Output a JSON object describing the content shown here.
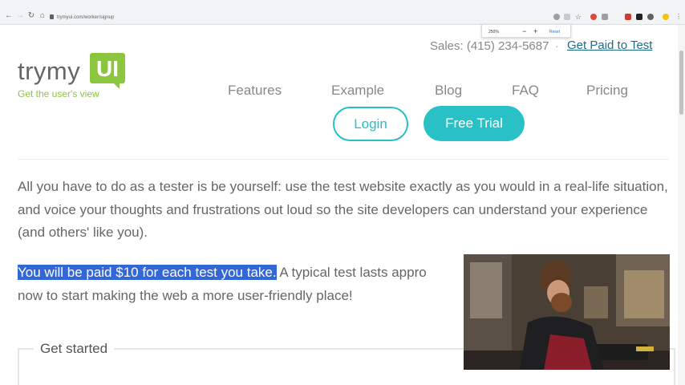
{
  "browser": {
    "url": "trymyui.com/worker/signup",
    "zoom_popup": {
      "percent": "250%",
      "minus": "−",
      "plus": "+",
      "reset": "Reset"
    }
  },
  "logo": {
    "word": "trymy",
    "box": "UI",
    "tagline": "Get the user's view"
  },
  "header": {
    "sales": "Sales: (415) 234-5687",
    "separator": "·",
    "paid_link": "Get Paid to Test"
  },
  "nav": [
    "Features",
    "Example",
    "Blog",
    "FAQ",
    "Pricing"
  ],
  "buttons": {
    "login": "Login",
    "free_trial": "Free Trial"
  },
  "content": {
    "para1": "All you have to do as a tester is be yourself: use the test website exactly as you would in a real-life situation, and voice your thoughts and frustrations out loud so the site developers can understand your experience (and others' like you).",
    "para2_highlight": "You will be paid $10 for each test you take.",
    "para2_rest": " A typical test lasts appro",
    "para2_line2": "now to start making the web a more user-friendly place!",
    "get_started": "Get started"
  },
  "colors": {
    "accent": "#29c1c5",
    "brand_green": "#8cc63f",
    "link": "#1b6b8c",
    "highlight": "#3367d6"
  }
}
